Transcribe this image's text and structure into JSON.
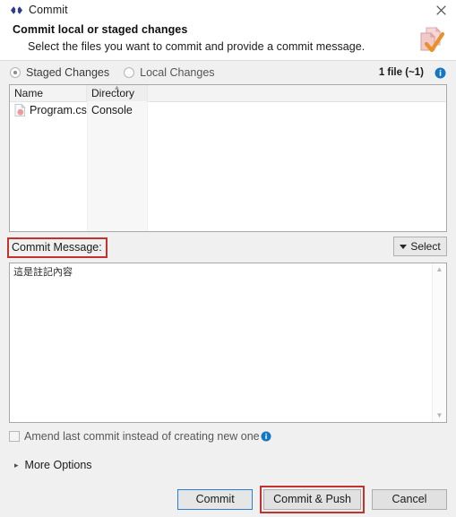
{
  "window": {
    "title": "Commit",
    "icon": "code-brackets-icon",
    "close_label": "×"
  },
  "header": {
    "title": "Commit local or staged changes",
    "subtitle": "Select the files you want to commit and provide a commit message.",
    "icon": "commit-documents-check-icon"
  },
  "source": {
    "staged_label": "Staged Changes",
    "local_label": "Local Changes",
    "selected": "Staged Changes",
    "file_count": "1 file (~1)",
    "info_icon": "info-icon"
  },
  "table": {
    "columns": [
      "Name",
      "Directory"
    ],
    "sort_column": "Directory",
    "sort_direction": "ascending",
    "rows": [
      {
        "name": "Program.cs",
        "directory": "Console",
        "icon": "csharp-file-icon"
      }
    ]
  },
  "commit_message": {
    "label": "Commit Message:",
    "select_button": "Select",
    "caret_icon": "chevron-down-icon",
    "value": "這是註記內容",
    "scroll_up_icon": "scroll-up-arrow",
    "scroll_down_icon": "scroll-down-arrow"
  },
  "amend": {
    "label": "Amend last commit instead of creating new one",
    "checked": false,
    "info_icon": "info-icon"
  },
  "more_options": {
    "label": "More Options",
    "caret_icon": "chevron-right-icon",
    "expanded": false
  },
  "footer": {
    "commit_label": "Commit",
    "commit_push_label": "Commit & Push",
    "cancel_label": "Cancel"
  },
  "colors": {
    "highlight_red": "#c3322f",
    "default_button_blue": "#2a7fd4",
    "window_background": "#f0f0f0",
    "accent_icon_orange": "#e8912a",
    "accent_icon_pink": "#efb9b9"
  }
}
